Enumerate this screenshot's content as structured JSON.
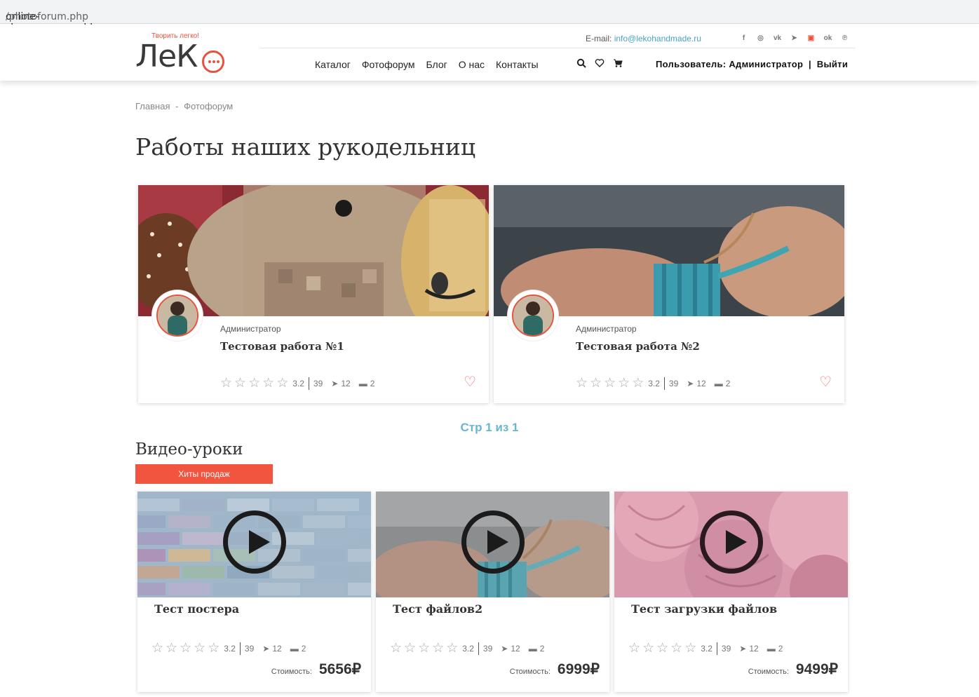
{
  "browser": {
    "url_host": "online-shop.название.hhos.ru",
    "url_path": "/photoforum.php"
  },
  "header": {
    "tagline": "Творить легко!",
    "logo_text": "ЛеК",
    "email_label": "E-mail:",
    "email": "info@lekohandmade.ru",
    "social": [
      {
        "icon": "facebook-icon",
        "glyph": "f"
      },
      {
        "icon": "instagram-icon",
        "glyph": "◎"
      },
      {
        "icon": "vk-icon",
        "glyph": "vk"
      },
      {
        "icon": "telegram-icon",
        "glyph": "➤"
      },
      {
        "icon": "youtube-icon",
        "glyph": "▣"
      },
      {
        "icon": "odnoklassniki-icon",
        "glyph": "ok"
      },
      {
        "icon": "pinterest-icon",
        "glyph": "℗"
      }
    ],
    "nav": [
      "Каталог",
      "Фотофорум",
      "Блог",
      "О нас",
      "Контакты"
    ],
    "user_label": "Пользователь:",
    "user_name": "Администратор",
    "logout": "Выйти",
    "accent": "#e7533e"
  },
  "breadcrumb": {
    "home": "Главная",
    "separator": "-",
    "current": "Фотофорум"
  },
  "page_title": "Работы наших рукодельниц",
  "photo_cards": [
    {
      "author": "Администратор",
      "title": "Тестовая работа №1",
      "rating": "3.2",
      "views": "39",
      "shares": "12",
      "comments": "2"
    },
    {
      "author": "Администратор",
      "title": "Тестовая работа №2",
      "rating": "3.2",
      "views": "39",
      "shares": "12",
      "comments": "2"
    }
  ],
  "pager": "Стр 1 из 1",
  "videos_heading": "Видео-уроки",
  "hits_button": "Хиты продаж",
  "video_cards": [
    {
      "title": "Тест постера",
      "rating": "3.2",
      "views": "39",
      "shares": "12",
      "comments": "2",
      "price_label": "Стоимость:",
      "price": "5656₽"
    },
    {
      "title": "Тест файлов2",
      "rating": "3.2",
      "views": "39",
      "shares": "12",
      "comments": "2",
      "price_label": "Стоимость:",
      "price": "6999₽"
    },
    {
      "title": "Тест загрузки файлов",
      "rating": "3.2",
      "views": "39",
      "shares": "12",
      "comments": "2",
      "price_label": "Стоимость:",
      "price": "9499₽"
    }
  ]
}
